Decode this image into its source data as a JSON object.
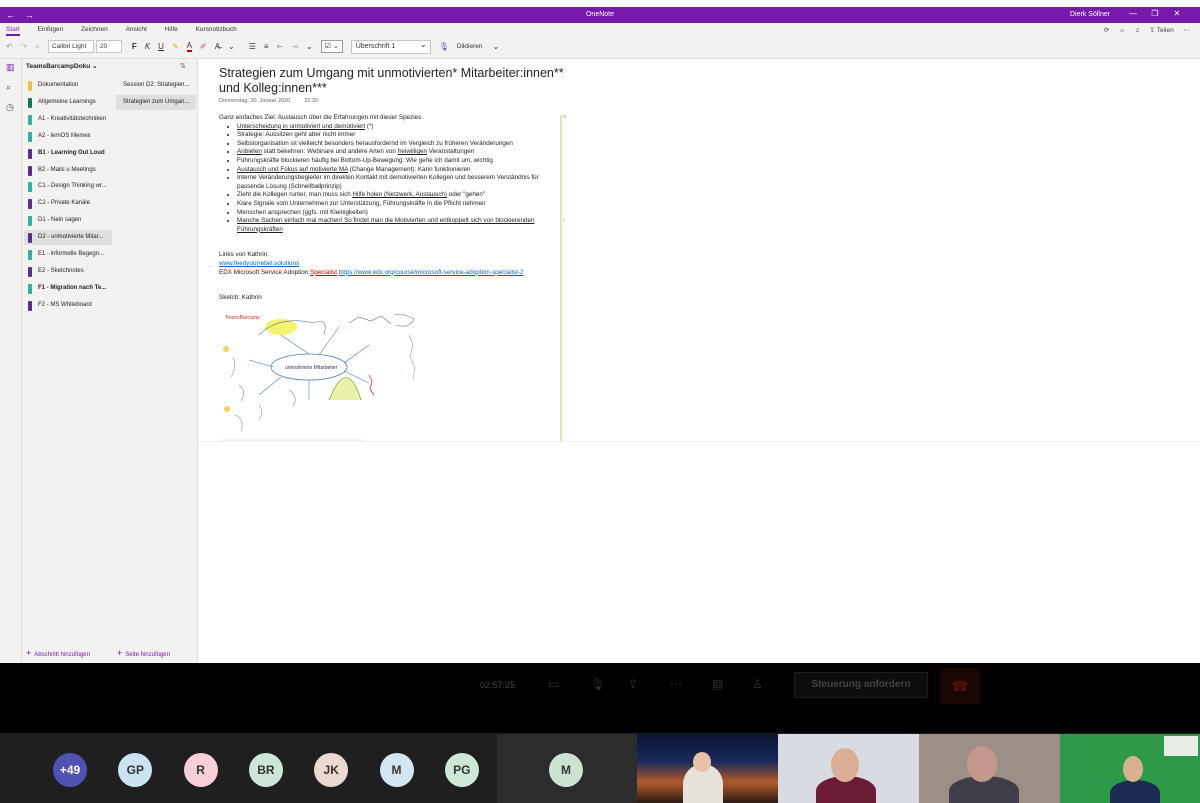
{
  "window": {
    "app_title": "OneNote",
    "user": "Dierk Söllner"
  },
  "ribbon": {
    "tabs": [
      "Start",
      "Einfügen",
      "Zeichnen",
      "Ansicht",
      "Hilfe",
      "Kursnotizbuch"
    ],
    "active_tab": "Start",
    "right_share": "Teilen",
    "font_name": "Calibri Light",
    "font_size": "20",
    "bold": "F",
    "italic": "K",
    "underline": "U",
    "style": "Überschrift 1",
    "dictate": "Diktieren",
    "accent_color": "#7719aa"
  },
  "notebook": {
    "name": "TeamsBarcampDoku",
    "sections": [
      {
        "label": "Dokumentation",
        "color": "#e8c547",
        "bold": false
      },
      {
        "label": "Allgemeine Learnings",
        "color": "#0b7a4e",
        "bold": false
      },
      {
        "label": "A1 - Kreativitätstechniken",
        "color": "#2bb3a3",
        "bold": false
      },
      {
        "label": "A2 - lernOS Memex",
        "color": "#2bb3a3",
        "bold": false
      },
      {
        "label": "B1 - Learning Out Loud",
        "color": "#5a2d91",
        "bold": true
      },
      {
        "label": "B2 - Mails u Meetings",
        "color": "#5a2d91",
        "bold": false
      },
      {
        "label": "C1 - Design Thinking wr...",
        "color": "#2bb3a3",
        "bold": false
      },
      {
        "label": "C2 - Private Kanäle",
        "color": "#5a2d91",
        "bold": false
      },
      {
        "label": "D1 - Nein sagen",
        "color": "#2bb3a3",
        "bold": false
      },
      {
        "label": "D2 - unmotivierte Mitar...",
        "color": "#5a2d91",
        "bold": false,
        "selected": true
      },
      {
        "label": "E1 - informelle Begegn...",
        "color": "#2bb3a3",
        "bold": false
      },
      {
        "label": "E2 - Sketchnotes",
        "color": "#5a2d91",
        "bold": false
      },
      {
        "label": "F1 - Migration nach Te...",
        "color": "#2bb3a3",
        "bold": true
      },
      {
        "label": "F2 - MS Whiteboard",
        "color": "#5a2d91",
        "bold": false
      }
    ],
    "pages": [
      {
        "label": "Session D2: Strategien...",
        "selected": false
      },
      {
        "label": "Strategien zum Umgan...",
        "selected": true
      }
    ],
    "add_section": "Abschnitt hinzufügen",
    "add_page": "Seite hinzufügen"
  },
  "page": {
    "title": "Strategien zum Umgang mit unmotivierten* Mitarbeiter:innen** und Kolleg:innen***",
    "date": "Donnerstag, 30. Januar 2020",
    "time": "22:35",
    "intro": "Ganz einfaches Ziel: Austausch über die Erfahrungen mit dieser Spezies",
    "bullets": [
      {
        "pre": "",
        "u": "Unterscheidung in unmotiviert und demotiviert",
        "post": " (*)"
      },
      {
        "pre": "Strategie: Aussitzen geht aber nicht immer",
        "u": "",
        "post": ""
      },
      {
        "pre": "Selbstorganisation ist vielleicht besonders herausfordernd im Vergleich zu früheren Veränderungen",
        "u": "",
        "post": ""
      },
      {
        "pre": "",
        "u": "Anbieten",
        "post": " statt bekehren: Webinare und andere Arten von ",
        "u2": "freiwilligen",
        "post2": " Veranstaltungen"
      },
      {
        "pre": "Führungskräfte blockieren häufig bei Bottom-Up-Bewegung: Wie gehe ich damit um, wichtig",
        "u": "",
        "post": ""
      },
      {
        "pre": "",
        "u": "Austausch und Fokus auf motivierte MA",
        "post": " (Change Management): Kann funktionieren"
      },
      {
        "pre": "Interne Veränderungsbegleiter im direkten Kontakt mit demotivierten Kollegen und besserem Verständnis für passende Lösung (Schnellballprinzip)",
        "u": "",
        "post": ""
      },
      {
        "pre": "Zieht die Kollegen runter, man muss sich ",
        "u": "Hilfe holen (Netzwerk, Austausch)",
        "post": " oder \"gehen\""
      },
      {
        "pre": "Klare Signale vom Unternehmen zur Unterstützung, Führungskräfte in die Pflicht nehmen",
        "u": "",
        "post": ""
      },
      {
        "pre": "Menschen ansprechen (ggfs. mit Kleinigkeiten)",
        "u": "",
        "post": ""
      },
      {
        "pre": "",
        "u": "Manche Sachen einfach mal machen! So findet man die Motivierten und entkoppelt sich von blockierenden Führungskräften",
        "post": ""
      }
    ],
    "links_heading": "Links von Kathrin:",
    "link1": "www.feedyourrebel.solutions",
    "edx_prefix": "EDX Microsoft Service Adoption ",
    "edx_red": "Specialist",
    "edx_url": "https://www.edx.org/course/microsoft-service-adoption-specialist-2",
    "sketch_heading": "Sketch: Kathrin",
    "sketch_center": "unmotivierte Mitarbeiter",
    "sketch_logo": "TeamsBarcamp"
  },
  "call": {
    "timer": "02:57:25",
    "request_control": "Steuerung anfordern"
  },
  "participants": [
    {
      "initials": "+49",
      "bg": "#4f52b2",
      "fg": "#ffffff"
    },
    {
      "initials": "GP",
      "bg": "#c9e4f0",
      "fg": "#333333"
    },
    {
      "initials": "R",
      "bg": "#f6d0d6",
      "fg": "#333333"
    },
    {
      "initials": "BR",
      "bg": "#cde6d8",
      "fg": "#333333"
    },
    {
      "initials": "JK",
      "bg": "#ead9d0",
      "fg": "#333333"
    },
    {
      "initials": "M",
      "bg": "#d3e6f2",
      "fg": "#333333"
    },
    {
      "initials": "PG",
      "bg": "#cde9d6",
      "fg": "#333333"
    }
  ],
  "featured": {
    "initials": "M",
    "bg": "#cde3d2"
  }
}
